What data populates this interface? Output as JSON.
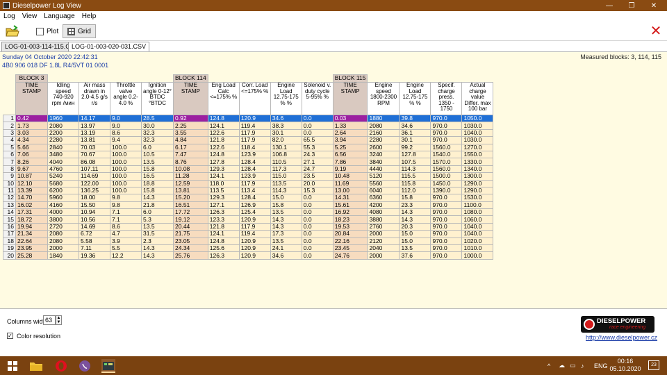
{
  "window": {
    "title": "Dieselpower Log View",
    "minimize": "—",
    "maximize": "❐",
    "close": "✕"
  },
  "menu": [
    "Log",
    "View",
    "Language",
    "Help"
  ],
  "toolbar": {
    "plot_label": "Plot",
    "grid_label": "Grid",
    "close_glyph": "✕"
  },
  "tabs": [
    "LOG-01-003-114-115.CSV",
    "LOG-01-003-020-031.CSV"
  ],
  "info": {
    "datetime": "Sunday 04 October 2020 22:42:31",
    "ecu": "4B0 906 018 DF  1.8L R4/5VT      01 0001",
    "measured_blocks": "Measured blocks: 3, 114, 115"
  },
  "grid": {
    "blocks": [
      "BLOCK 3",
      "BLOCK 114",
      "BLOCK 115"
    ],
    "headers": [
      "TIME STAMP",
      "Idling speed 740-920 rpm /мин",
      "Air mass drawn in 2.0-4.5 g/s r/s",
      "Throttle valve angle 0.2-4.0 %",
      "Ignition angle 0-12° BTDC °BTDC",
      "TIME STAMP",
      "Eng Load Calc <=175% %",
      "Corr. Load <=175% %",
      "Engine Load 12.75-175 % %",
      "Solenoid v. duty cycle 5-95% %",
      "TIME STAMP",
      "Engine speed 1800-2300 RPM",
      "Engine Load 12.75-175 % %",
      "Specif. charge press. 1350 - 1750",
      "Actual charge value Differ. max 100 bar"
    ],
    "rows": [
      [
        "1",
        "0.42",
        "1960",
        "14.17",
        "9.0",
        "28.5",
        "0.92",
        "124.8",
        "120.9",
        "34.6",
        "0.0",
        "0.03",
        "1880",
        "39.8",
        "970.0",
        "1050.0"
      ],
      [
        "2",
        "1.73",
        "2080",
        "13.97",
        "9.0",
        "30.0",
        "2.25",
        "124.1",
        "119.4",
        "38.3",
        "0.0",
        "1.33",
        "2080",
        "34.6",
        "970.0",
        "1030.0"
      ],
      [
        "3",
        "3.03",
        "2200",
        "13.19",
        "8.6",
        "32.3",
        "3.55",
        "122.6",
        "117.9",
        "30.1",
        "0.0",
        "2.64",
        "2160",
        "36.1",
        "970.0",
        "1040.0"
      ],
      [
        "4",
        "4.34",
        "2280",
        "13.81",
        "9.4",
        "32.3",
        "4.84",
        "121.8",
        "117.9",
        "82.0",
        "65.5",
        "3.94",
        "2280",
        "30.1",
        "970.0",
        "1030.0"
      ],
      [
        "5",
        "5.66",
        "2840",
        "70.03",
        "100.0",
        "6.0",
        "6.17",
        "122.6",
        "118.4",
        "130.1",
        "55.3",
        "5.25",
        "2600",
        "99.2",
        "1560.0",
        "1270.0"
      ],
      [
        "6",
        "7.06",
        "3480",
        "70.67",
        "100.0",
        "10.5",
        "7.47",
        "124.8",
        "123.9",
        "106.8",
        "24.3",
        "6.56",
        "3240",
        "127.8",
        "1540.0",
        "1550.0"
      ],
      [
        "7",
        "8.26",
        "4040",
        "86.08",
        "100.0",
        "13.5",
        "8.76",
        "127.8",
        "128.4",
        "110.5",
        "27.1",
        "7.86",
        "3840",
        "107.5",
        "1570.0",
        "1330.0"
      ],
      [
        "8",
        "9.67",
        "4760",
        "107.11",
        "100.0",
        "15.8",
        "10.08",
        "129.3",
        "128.4",
        "117.3",
        "24.7",
        "9.19",
        "4440",
        "114.3",
        "1560.0",
        "1340.0"
      ],
      [
        "9",
        "10.87",
        "5240",
        "114.69",
        "100.0",
        "16.5",
        "11.28",
        "124.1",
        "123.9",
        "115.0",
        "23.5",
        "10.48",
        "5120",
        "115.5",
        "1500.0",
        "1300.0"
      ],
      [
        "10",
        "12.10",
        "5680",
        "122.00",
        "100.0",
        "18.8",
        "12.59",
        "118.0",
        "117.9",
        "113.5",
        "20.0",
        "11.69",
        "5560",
        "115.8",
        "1450.0",
        "1290.0"
      ],
      [
        "11",
        "13.39",
        "6200",
        "136.25",
        "100.0",
        "15.8",
        "13.81",
        "113.5",
        "113.4",
        "114.3",
        "15.3",
        "13.00",
        "6040",
        "112.0",
        "1390.0",
        "1290.0"
      ],
      [
        "12",
        "14.70",
        "5960",
        "18.00",
        "9.8",
        "14.3",
        "15.20",
        "129.3",
        "128.4",
        "15.0",
        "0.0",
        "14.31",
        "6360",
        "15.8",
        "970.0",
        "1530.0"
      ],
      [
        "13",
        "16.02",
        "4160",
        "15.50",
        "9.8",
        "21.8",
        "16.51",
        "127.1",
        "126.9",
        "15.8",
        "0.0",
        "15.61",
        "4200",
        "23.3",
        "970.0",
        "1100.0"
      ],
      [
        "14",
        "17.31",
        "4000",
        "10.94",
        "7.1",
        "6.0",
        "17.72",
        "126.3",
        "125.4",
        "13.5",
        "0.0",
        "16.92",
        "4080",
        "14.3",
        "970.0",
        "1080.0"
      ],
      [
        "15",
        "18.72",
        "3800",
        "10.56",
        "7.1",
        "5.3",
        "19.12",
        "123.3",
        "120.9",
        "14.3",
        "0.0",
        "18.23",
        "3880",
        "14.3",
        "970.0",
        "1060.0"
      ],
      [
        "16",
        "19.94",
        "2720",
        "14.69",
        "8.6",
        "13.5",
        "20.44",
        "121.8",
        "117.9",
        "14.3",
        "0.0",
        "19.53",
        "2760",
        "20.3",
        "970.0",
        "1040.0"
      ],
      [
        "17",
        "21.34",
        "2080",
        "6.72",
        "4.7",
        "31.5",
        "21.75",
        "124.1",
        "119.4",
        "17.3",
        "0.0",
        "20.84",
        "2000",
        "15.0",
        "970.0",
        "1040.0"
      ],
      [
        "18",
        "22.64",
        "2080",
        "5.58",
        "3.9",
        "2.3",
        "23.05",
        "124.8",
        "120.9",
        "13.5",
        "0.0",
        "22.16",
        "2120",
        "15.0",
        "970.0",
        "1020.0"
      ],
      [
        "19",
        "23.95",
        "2000",
        "7.11",
        "5.5",
        "14.3",
        "24.34",
        "125.6",
        "120.9",
        "24.1",
        "0.0",
        "23.45",
        "2040",
        "13.5",
        "970.0",
        "1010.0"
      ],
      [
        "20",
        "25.28",
        "1840",
        "19.36",
        "12.2",
        "14.3",
        "25.76",
        "126.3",
        "120.9",
        "34.6",
        "0.0",
        "24.76",
        "2000",
        "37.6",
        "970.0",
        "1000.0"
      ]
    ]
  },
  "bottom": {
    "columns_width_label": "Columns width:",
    "columns_width_value": "63",
    "color_resolution_label": "Color resolution",
    "color_resolution_checked": "✓",
    "logo_main": "DIESELPOWER",
    "logo_sub": "race engineering",
    "website": "http://www.dieselpower.cz"
  },
  "taskbar": {
    "time": "00:16",
    "date": "05.10.2020",
    "language": "ENG",
    "notifications": "23",
    "tray_icons": [
      "^",
      "☁",
      "▭",
      "♪"
    ]
  }
}
